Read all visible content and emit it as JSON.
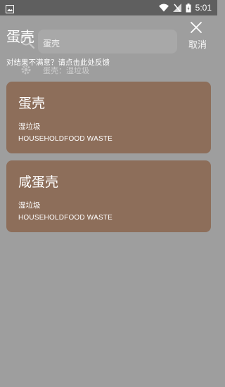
{
  "status_bar": {
    "time": "5:01",
    "icons": [
      "image-icon",
      "wifi-icon",
      "signal-icon",
      "battery-icon"
    ]
  },
  "background": {
    "search_value": "蛋壳",
    "cancel_label": "取消",
    "history_item": "蛋壳：湿垃圾"
  },
  "overlay": {
    "title": "蛋壳",
    "feedback": "对结果不满意？请点击此处反馈",
    "results": [
      {
        "name": "蛋壳",
        "category": "湿垃圾",
        "category_en": "HOUSEHOLDFOOD WASTE"
      },
      {
        "name": "咸蛋壳",
        "category": "湿垃圾",
        "category_en": "HOUSEHOLDFOOD WASTE"
      }
    ]
  },
  "colors": {
    "scrim": "#9e9e9e",
    "status_bar": "#5f5f5f",
    "card": "#8d6e5a"
  }
}
